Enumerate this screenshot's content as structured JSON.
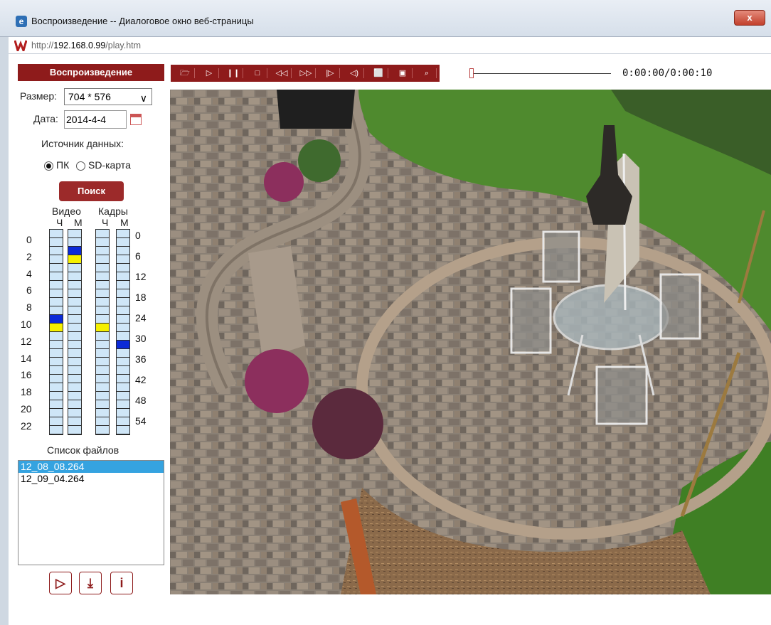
{
  "window": {
    "title": "Воспроизведение -- Диалоговое окно веб-страницы",
    "close_label": "x"
  },
  "address": {
    "scheme": "http://",
    "host": "192.168.0.99",
    "path": "/play.htm"
  },
  "panel": {
    "title": "Воспроизведение",
    "size_label": "Размер:",
    "size_value": "704 * 576",
    "date_label": "Дата:",
    "date_value": "2014-4-4",
    "source_label": "Источник данных:",
    "source_options": [
      "ПК",
      "SD-карта"
    ],
    "source_selected": "ПК",
    "search_label": "Поиск",
    "video_label": "Видео",
    "frames_label": "Кадры",
    "hour_short": "Ч",
    "minute_short": "М",
    "hour_ticks": [
      "0",
      "2",
      "4",
      "6",
      "8",
      "10",
      "12",
      "14",
      "16",
      "18",
      "20",
      "22"
    ],
    "minute_ticks": [
      "0",
      "6",
      "12",
      "18",
      "24",
      "30",
      "36",
      "42",
      "48",
      "54"
    ],
    "files_label": "Список файлов",
    "files": [
      "12_08_08.264",
      "12_09_04.264"
    ],
    "selected_file": "12_08_08.264"
  },
  "timeline_marks": {
    "video_hours": [
      {
        "slot": 10,
        "color": "blue"
      },
      {
        "slot": 11,
        "color": "yellow"
      }
    ],
    "video_minutes": [
      {
        "slot": 2,
        "color": "blue"
      },
      {
        "slot": 3,
        "color": "yellow"
      }
    ],
    "frames_hours": [
      {
        "slot": 11,
        "color": "yellow"
      }
    ],
    "frames_minutes": [
      {
        "slot": 13,
        "color": "blue"
      }
    ]
  },
  "toolbar": {
    "buttons": [
      "open-icon",
      "play-icon",
      "pause-icon",
      "stop-icon",
      "rewind-icon",
      "fast-forward-icon",
      "step-icon",
      "volume-icon",
      "fullscreen-icon",
      "snapshot-icon",
      "zoom-icon"
    ]
  },
  "player": {
    "time": "0:00:00/0:00:10",
    "progress": 0
  },
  "bottom_buttons": [
    "play-file-icon",
    "download-icon",
    "info-icon"
  ],
  "colors": {
    "accent": "#8e1b1b",
    "selection": "#35a3e0",
    "mark_blue": "#0b2ad8",
    "mark_yellow": "#f5f000"
  }
}
